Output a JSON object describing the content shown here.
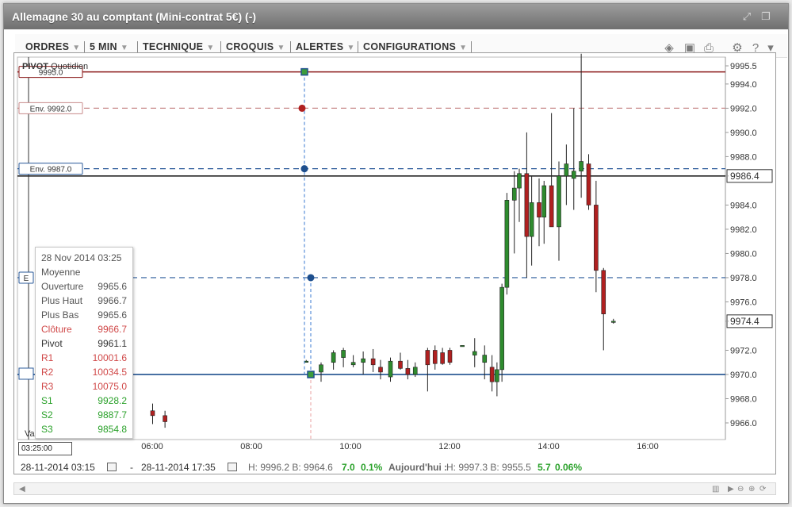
{
  "window": {
    "title": "Allemagne 30 au comptant (Mini-contrat 5€) (-)"
  },
  "toolbar": {
    "menus": [
      "ORDRES",
      "5 MIN",
      "TECHNIQUE",
      "CROQUIS",
      "ALERTES",
      "CONFIGURATIONS"
    ],
    "icons": [
      "layers-icon",
      "image-icon",
      "print-icon",
      "gear-icon",
      "help-icon",
      "pin-icon"
    ]
  },
  "indicator": {
    "name": "PIVOT",
    "period": "Quotidien"
  },
  "chart_data": {
    "type": "candlestick",
    "y_axis_labels": [
      "9995.5",
      "9994.0",
      "9992.0",
      "9990.0",
      "9988.0",
      "9986.4",
      "9984.0",
      "9982.0",
      "9980.0",
      "9978.0",
      "9976.0",
      "9974.4",
      "9972.0",
      "9970.0",
      "9968.0",
      "9966.0"
    ],
    "highlighted_prices": [
      "9986.4",
      "9974.4"
    ],
    "x_axis_labels": [
      "06:00",
      "08:00",
      "10:00",
      "12:00",
      "14:00",
      "16:00"
    ],
    "ylim": [
      9965,
      9996.5
    ],
    "horizontal_lines": [
      {
        "price": 9995.0,
        "color": "#8b1a1a",
        "style": "solid",
        "label": "9995.0"
      },
      {
        "price": 9992.0,
        "color": "#c88a8a",
        "style": "dashed",
        "label": "Env. 9992.0"
      },
      {
        "price": 9987.0,
        "color": "#2a5a9a",
        "style": "dashed",
        "label": "Env. 9987.0"
      },
      {
        "price": 9986.4,
        "color": "#222222",
        "style": "solid",
        "label": ""
      },
      {
        "price": 9978.0,
        "color": "#2a5a9a",
        "style": "dashed",
        "label": "E"
      },
      {
        "price": 9970.0,
        "color": "#1e4f8e",
        "style": "solid",
        "label": ""
      }
    ],
    "candles": [
      {
        "t": 0.0,
        "o": 9967.0,
        "h": 9967.6,
        "l": 9965.9,
        "c": 9966.6
      },
      {
        "t": 0.25,
        "o": 9966.6,
        "h": 9967.0,
        "l": 9965.6,
        "c": 9966.1
      },
      {
        "t": 3.1,
        "o": 9971.1,
        "h": 9971.2,
        "l": 9971.0,
        "c": 9971.1
      },
      {
        "t": 3.4,
        "o": 9970.2,
        "h": 9971.0,
        "l": 9969.4,
        "c": 9970.8
      },
      {
        "t": 3.65,
        "o": 9971.0,
        "h": 9972.0,
        "l": 9970.4,
        "c": 9971.8
      },
      {
        "t": 3.85,
        "o": 9971.4,
        "h": 9972.2,
        "l": 9970.6,
        "c": 9972.0
      },
      {
        "t": 4.05,
        "o": 9970.8,
        "h": 9971.6,
        "l": 9970.6,
        "c": 9971.0
      },
      {
        "t": 4.25,
        "o": 9971.0,
        "h": 9971.9,
        "l": 9970.0,
        "c": 9971.3
      },
      {
        "t": 4.45,
        "o": 9971.3,
        "h": 9972.1,
        "l": 9970.2,
        "c": 9970.8
      },
      {
        "t": 4.6,
        "o": 9970.6,
        "h": 9971.2,
        "l": 9969.6,
        "c": 9970.2
      },
      {
        "t": 4.8,
        "o": 9969.8,
        "h": 9971.4,
        "l": 9969.4,
        "c": 9971.1
      },
      {
        "t": 5.0,
        "o": 9971.1,
        "h": 9971.8,
        "l": 9970.4,
        "c": 9970.5
      },
      {
        "t": 5.15,
        "o": 9970.5,
        "h": 9971.2,
        "l": 9969.6,
        "c": 9970.0
      },
      {
        "t": 5.3,
        "o": 9970.0,
        "h": 9971.0,
        "l": 9969.8,
        "c": 9970.6
      },
      {
        "t": 5.55,
        "o": 9972.0,
        "h": 9972.2,
        "l": 9968.6,
        "c": 9970.8
      },
      {
        "t": 5.7,
        "o": 9972.0,
        "h": 9972.4,
        "l": 9970.4,
        "c": 9970.9
      },
      {
        "t": 5.85,
        "o": 9971.8,
        "h": 9972.2,
        "l": 9970.8,
        "c": 9970.9
      },
      {
        "t": 6.0,
        "o": 9972.0,
        "h": 9972.2,
        "l": 9970.8,
        "c": 9971.0
      },
      {
        "t": 6.25,
        "o": 9972.4,
        "h": 9972.4,
        "l": 9972.4,
        "c": 9972.4
      },
      {
        "t": 6.5,
        "o": 9971.6,
        "h": 9973.0,
        "l": 9970.6,
        "c": 9971.9
      },
      {
        "t": 6.7,
        "o": 9971.0,
        "h": 9972.4,
        "l": 9969.6,
        "c": 9971.6
      },
      {
        "t": 6.85,
        "o": 9970.6,
        "h": 9971.6,
        "l": 9968.6,
        "c": 9969.4
      },
      {
        "t": 6.95,
        "o": 9969.4,
        "h": 9971.0,
        "l": 9968.2,
        "c": 9970.4
      },
      {
        "t": 7.05,
        "o": 9970.4,
        "h": 9977.5,
        "l": 9969.4,
        "c": 9977.2
      },
      {
        "t": 7.15,
        "o": 9977.2,
        "h": 9985.0,
        "l": 9976.6,
        "c": 9984.4
      },
      {
        "t": 7.3,
        "o": 9984.4,
        "h": 9986.8,
        "l": 9980.0,
        "c": 9985.4
      },
      {
        "t": 7.4,
        "o": 9985.4,
        "h": 9987.0,
        "l": 9982.6,
        "c": 9986.6
      },
      {
        "t": 7.55,
        "o": 9986.6,
        "h": 9990.0,
        "l": 9978.0,
        "c": 9981.4
      },
      {
        "t": 7.65,
        "o": 9981.4,
        "h": 9986.4,
        "l": 9979.0,
        "c": 9984.2
      },
      {
        "t": 7.8,
        "o": 9984.2,
        "h": 9986.2,
        "l": 9980.6,
        "c": 9983.0
      },
      {
        "t": 7.9,
        "o": 9983.0,
        "h": 9986.0,
        "l": 9980.8,
        "c": 9985.6
      },
      {
        "t": 8.05,
        "o": 9985.6,
        "h": 9991.6,
        "l": 9983.0,
        "c": 9982.2
      },
      {
        "t": 8.2,
        "o": 9982.2,
        "h": 9987.6,
        "l": 9979.4,
        "c": 9986.4
      },
      {
        "t": 8.35,
        "o": 9986.4,
        "h": 9989.0,
        "l": 9984.0,
        "c": 9987.4
      },
      {
        "t": 8.5,
        "o": 9986.2,
        "h": 9992.0,
        "l": 9983.6,
        "c": 9986.8
      },
      {
        "t": 8.65,
        "o": 9986.8,
        "h": 9996.5,
        "l": 9984.6,
        "c": 9987.6
      },
      {
        "t": 8.8,
        "o": 9987.4,
        "h": 9988.2,
        "l": 9983.6,
        "c": 9984.0
      },
      {
        "t": 8.95,
        "o": 9984.0,
        "h": 9986.0,
        "l": 9976.8,
        "c": 9978.6
      },
      {
        "t": 9.1,
        "o": 9978.6,
        "h": 9978.8,
        "l": 9972.0,
        "c": 9975.0
      },
      {
        "t": 9.3,
        "o": 9974.4,
        "h": 9974.6,
        "l": 9974.2,
        "c": 9974.4
      }
    ]
  },
  "tooltip": {
    "date": "28 Nov 2014 03:25",
    "subtitle": "Moyenne",
    "rows": [
      {
        "label": "Ouverture",
        "value": "9965.6",
        "color": "#555555"
      },
      {
        "label": "Plus Haut",
        "value": "9966.7",
        "color": "#555555"
      },
      {
        "label": "Plus Bas",
        "value": "9965.6",
        "color": "#555555"
      },
      {
        "label": "Clôture",
        "value": "9966.7",
        "color": "#d04848"
      },
      {
        "label": "Pivot",
        "value": "9961.1",
        "color": "#333333"
      },
      {
        "label": "R1",
        "value": "10001.6",
        "color": "#d04848"
      },
      {
        "label": "R2",
        "value": "10034.5",
        "color": "#d04848"
      },
      {
        "label": "R3",
        "value": "10075.0",
        "color": "#d04848"
      },
      {
        "label": "S1",
        "value": "9928.2",
        "color": "#2aa12a"
      },
      {
        "label": "S2",
        "value": "9887.7",
        "color": "#2aa12a"
      },
      {
        "label": "S3",
        "value": "9854.8",
        "color": "#2aa12a"
      }
    ]
  },
  "crosshair_time": "03:25:00",
  "stub_label": "Va",
  "status": {
    "from": "28-11-2014 03:15",
    "dash": "-",
    "to": "28-11-2014 17:35",
    "range": "H: 9996.2  B: 9964.6",
    "change": "7.0",
    "change_pct": "0.1%",
    "today_label": "Aujourd'hui :",
    "today_range": "H: 9997.3  B: 9955.5",
    "today_change": "5.7",
    "today_pct": "0.06%"
  }
}
